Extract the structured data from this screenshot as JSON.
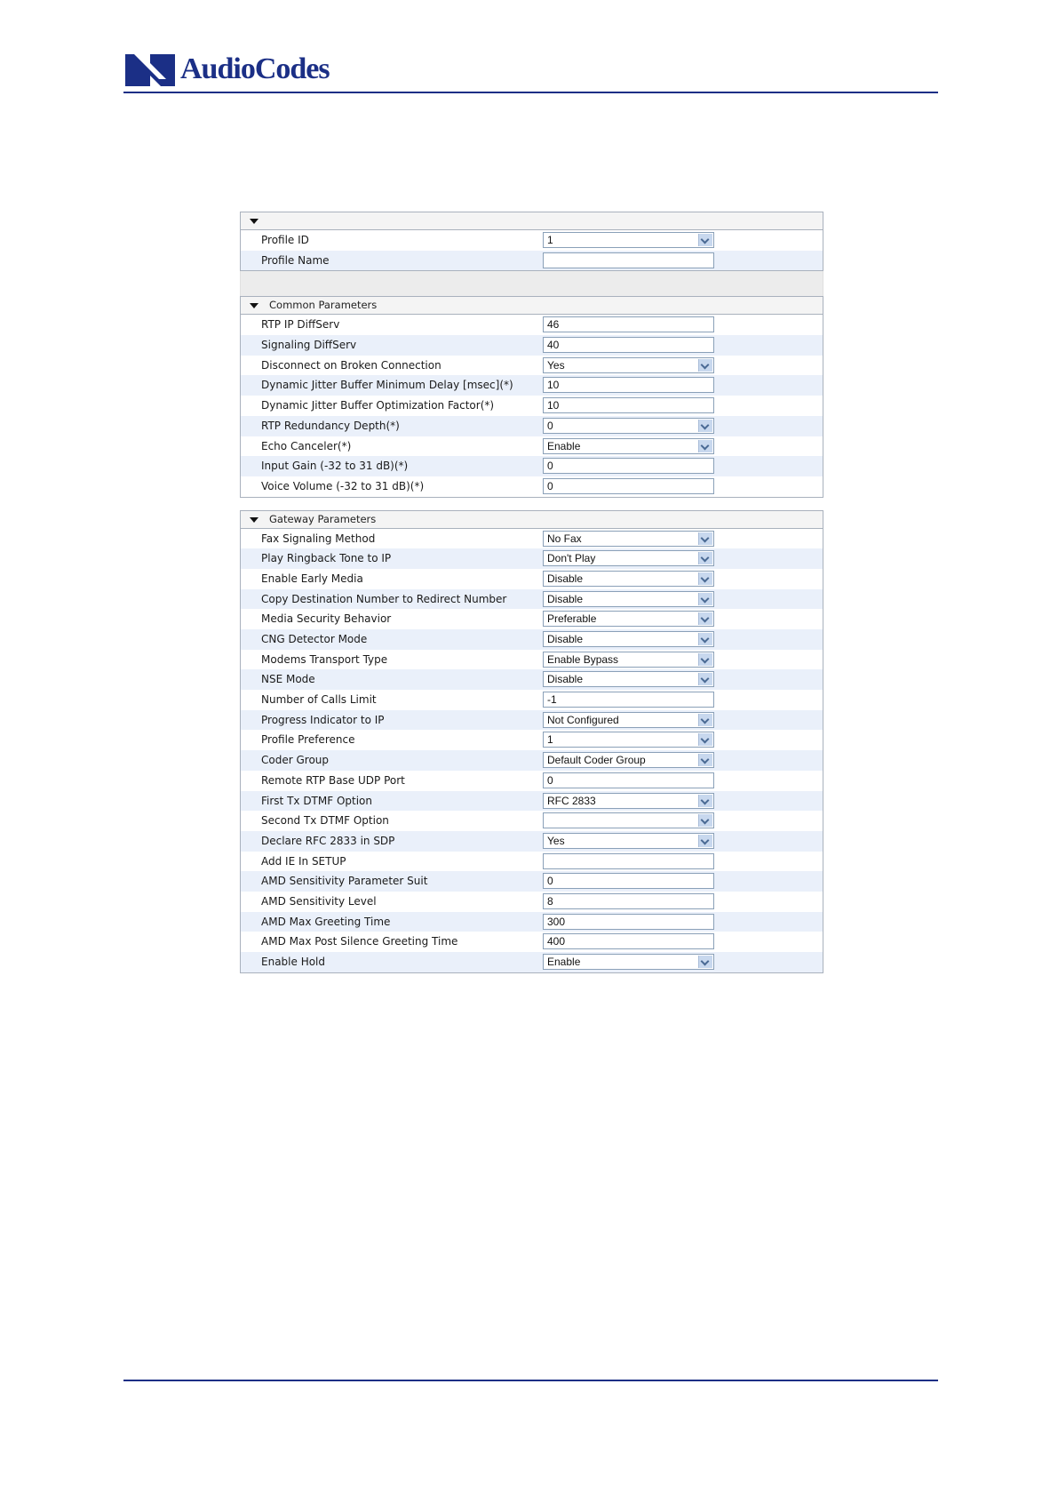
{
  "brand": {
    "name": "AudioCodes",
    "color": "#1b2f86"
  },
  "general": {
    "title": "",
    "rows": [
      {
        "label": "Profile ID",
        "type": "select",
        "value": "1"
      },
      {
        "label": "Profile Name",
        "type": "text",
        "value": ""
      }
    ]
  },
  "common": {
    "title": "Common Parameters",
    "rows": [
      {
        "label": "RTP IP DiffServ",
        "type": "text",
        "value": "46"
      },
      {
        "label": "Signaling DiffServ",
        "type": "text",
        "value": "40"
      },
      {
        "label": "Disconnect on Broken Connection",
        "type": "select",
        "value": "Yes"
      },
      {
        "label": "Dynamic Jitter Buffer Minimum Delay [msec](*)",
        "type": "text",
        "value": "10"
      },
      {
        "label": "Dynamic Jitter Buffer Optimization Factor(*)",
        "type": "text",
        "value": "10"
      },
      {
        "label": "RTP Redundancy Depth(*)",
        "type": "select",
        "value": "0"
      },
      {
        "label": "Echo Canceler(*)",
        "type": "select",
        "value": "Enable"
      },
      {
        "label": "Input Gain (-32 to 31 dB)(*)",
        "type": "text",
        "value": "0"
      },
      {
        "label": "Voice Volume (-32 to 31 dB)(*)",
        "type": "text",
        "value": "0"
      }
    ]
  },
  "gateway": {
    "title": "Gateway Parameters",
    "rows": [
      {
        "label": "Fax Signaling Method",
        "type": "select",
        "value": "No Fax"
      },
      {
        "label": "Play Ringback Tone to IP",
        "type": "select",
        "value": "Don't Play"
      },
      {
        "label": "Enable Early Media",
        "type": "select",
        "value": "Disable"
      },
      {
        "label": "Copy Destination Number to Redirect Number",
        "type": "select",
        "value": "Disable"
      },
      {
        "label": "Media Security Behavior",
        "type": "select",
        "value": "Preferable"
      },
      {
        "label": "CNG Detector Mode",
        "type": "select",
        "value": "Disable"
      },
      {
        "label": "Modems Transport Type",
        "type": "select",
        "value": "Enable Bypass"
      },
      {
        "label": "NSE Mode",
        "type": "select",
        "value": "Disable"
      },
      {
        "label": "Number of Calls Limit",
        "type": "text",
        "value": "-1"
      },
      {
        "label": "Progress Indicator to IP",
        "type": "select",
        "value": "Not Configured"
      },
      {
        "label": "Profile Preference",
        "type": "select",
        "value": "1"
      },
      {
        "label": "Coder Group",
        "type": "select",
        "value": "Default Coder Group"
      },
      {
        "label": "Remote RTP Base UDP Port",
        "type": "text",
        "value": "0"
      },
      {
        "label": "First Tx DTMF Option",
        "type": "select",
        "value": "RFC 2833"
      },
      {
        "label": "Second Tx DTMF Option",
        "type": "select",
        "value": ""
      },
      {
        "label": "Declare RFC 2833 in SDP",
        "type": "select",
        "value": "Yes"
      },
      {
        "label": "Add IE In SETUP",
        "type": "text",
        "value": ""
      },
      {
        "label": "AMD Sensitivity Parameter Suit",
        "type": "text",
        "value": "0"
      },
      {
        "label": "AMD Sensitivity Level",
        "type": "text",
        "value": "8"
      },
      {
        "label": "AMD Max Greeting Time",
        "type": "text",
        "value": "300"
      },
      {
        "label": "AMD Max Post Silence Greeting Time",
        "type": "text",
        "value": "400"
      },
      {
        "label": "Enable Hold",
        "type": "select",
        "value": "Enable"
      }
    ]
  }
}
